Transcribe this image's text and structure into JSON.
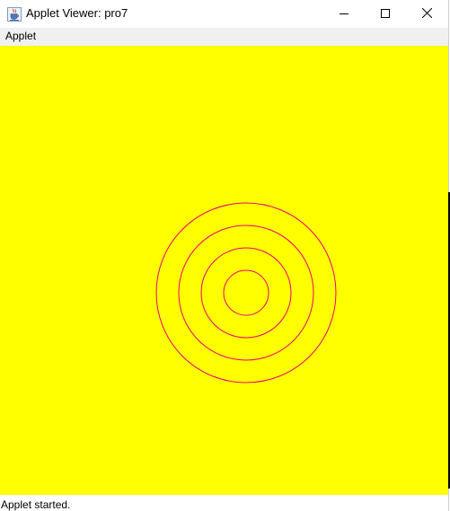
{
  "window": {
    "title": "Applet Viewer: pro7",
    "icon": "java-coffee-cup-icon"
  },
  "controls": {
    "minimize_icon": "minimize-icon",
    "maximize_icon": "maximize-icon",
    "close_icon": "close-icon"
  },
  "menubar": {
    "items": [
      {
        "label": "Applet"
      }
    ]
  },
  "applet": {
    "background_color": "#ffff00",
    "circle_color": "#e8007c",
    "circle_count": 4
  },
  "status": {
    "text": "Applet started."
  }
}
